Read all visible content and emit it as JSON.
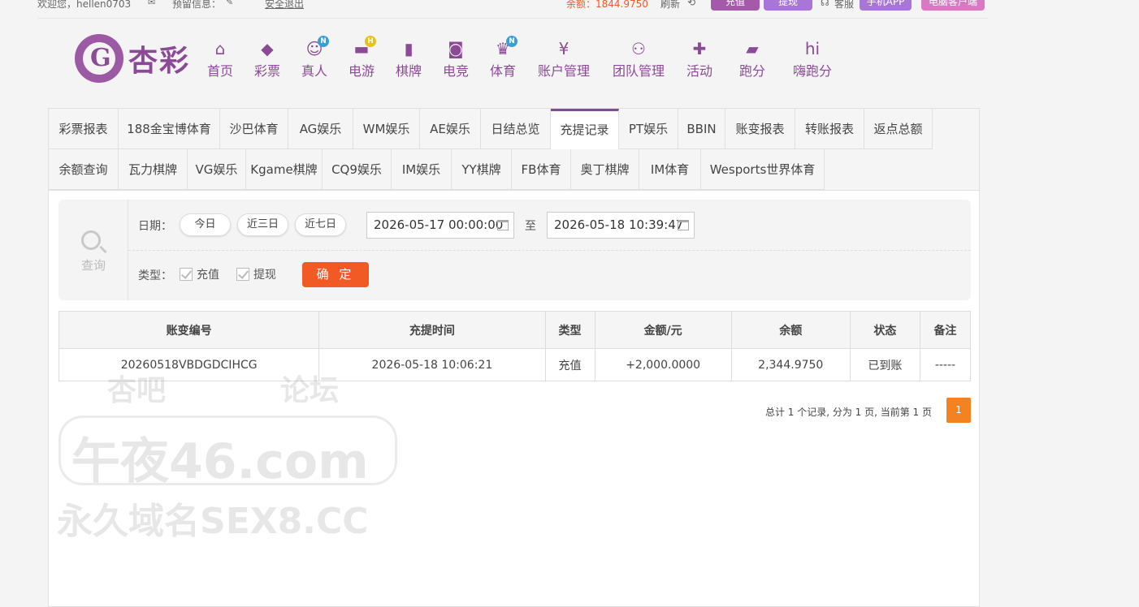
{
  "topbar": {
    "welcome": "欢迎您，hellen0703",
    "messages": "预留信息：",
    "logout": "安全退出",
    "balance": "余额：1844.9750",
    "refresh": "刷新",
    "deposit": "充值",
    "withdraw": "提现",
    "service": "客服",
    "mobile_app": "手机APP",
    "pc_client": "电脑客户端"
  },
  "brand": {
    "name": "杏彩",
    "logo_char": "G"
  },
  "nav": [
    {
      "label": "首页",
      "icon": "home-icon",
      "glyph": "⌂"
    },
    {
      "label": "彩票",
      "icon": "lottery-icon",
      "glyph": "◆"
    },
    {
      "label": "真人",
      "icon": "live-icon",
      "glyph": "☺",
      "badge": "N"
    },
    {
      "label": "电游",
      "icon": "gamepad-icon",
      "glyph": "▬",
      "badge": "H"
    },
    {
      "label": "棋牌",
      "icon": "cards-icon",
      "glyph": "▮"
    },
    {
      "label": "电竞",
      "icon": "esports-icon",
      "glyph": "◙"
    },
    {
      "label": "体育",
      "icon": "trophy-icon",
      "glyph": "♛",
      "badge": "N"
    },
    {
      "label": "账户管理",
      "icon": "yen-icon",
      "glyph": "¥"
    },
    {
      "label": "团队管理",
      "icon": "team-icon",
      "glyph": "⚇"
    },
    {
      "label": "活动",
      "icon": "gift-icon",
      "glyph": "✚"
    },
    {
      "label": "跑分",
      "icon": "car-icon",
      "glyph": "▰"
    },
    {
      "label": "嗨跑分",
      "icon": "hi-icon",
      "glyph": "hi"
    }
  ],
  "tabs_row1": [
    "彩票报表",
    "188金宝博体育",
    "沙巴体育",
    "AG娱乐",
    "WM娱乐",
    "AE娱乐",
    "日结总览",
    "充提记录",
    "PT娱乐",
    "BBIN",
    "账变报表",
    "转账报表",
    "返点总额"
  ],
  "tabs_row2": [
    "余额查询",
    "瓦力棋牌",
    "VG娱乐",
    "Kgame棋牌",
    "CQ9娱乐",
    "IM娱乐",
    "YY棋牌",
    "FB体育",
    "奥丁棋牌",
    "IM体育",
    "Wesports世界体育"
  ],
  "active_tab": "充提记录",
  "query": {
    "title": "查询",
    "date_label": "日期：",
    "quick": [
      "今日",
      "近三日",
      "近七日"
    ],
    "start": "2026-05-17 00:00:00",
    "to": "至",
    "end": "2026-05-18 10:39:47",
    "type_label": "类型：",
    "types": [
      "充值",
      "提现"
    ],
    "confirm": "确 定"
  },
  "table": {
    "headers": [
      "账变编号",
      "充提时间",
      "类型",
      "金额/元",
      "余额",
      "状态",
      "备注"
    ],
    "rows": [
      {
        "id": "20260518VBDGDCIHCG",
        "time": "2026-05-18 10:06:21",
        "type": "充值",
        "amount": "+2,000.0000",
        "balance": "2,344.9750",
        "status": "已到账",
        "note": "-----"
      }
    ]
  },
  "pager": {
    "summary": "总计 1 个记录, 分为 1 页, 当前第 1 页",
    "current": "1"
  },
  "watermark": {
    "line1a": "杏吧",
    "line1b": "论坛",
    "line2": "午夜46.com",
    "line3": "永久域名SEX8.CC"
  },
  "colors": {
    "brand": "#8b4a95",
    "accent": "#f15a24",
    "pager": "#f58220"
  }
}
